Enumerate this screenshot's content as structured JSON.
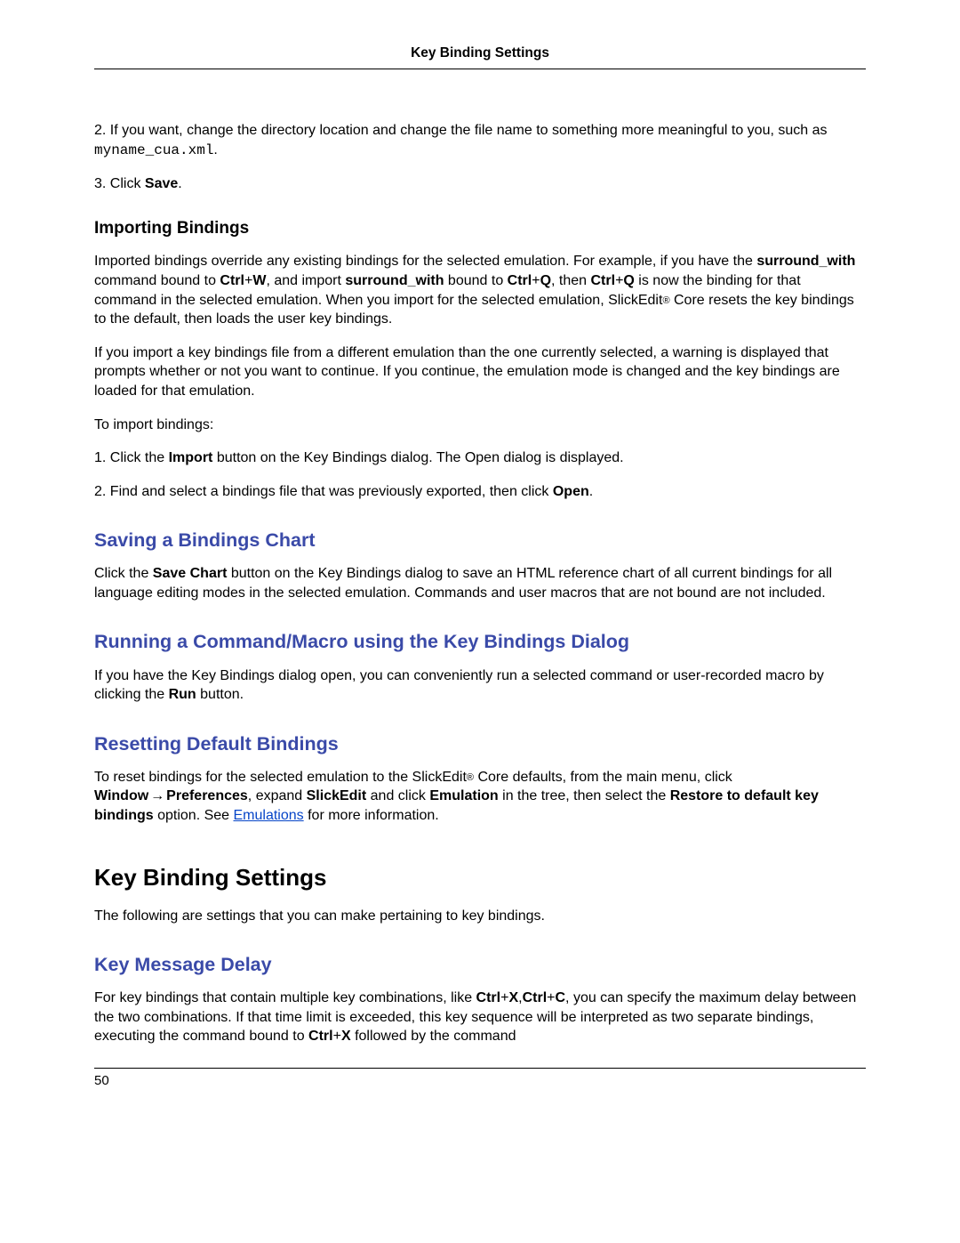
{
  "header": {
    "title": "Key Binding Settings"
  },
  "step2": {
    "num": "2.",
    "pre": "If you want, change the directory location and change the file name to something more meaningful to you, such as ",
    "mono": "myname_cua.xml",
    "post": "."
  },
  "step3": {
    "num": "3.",
    "pre": "Click ",
    "b": "Save",
    "post": "."
  },
  "importing": {
    "heading": "Importing Bindings",
    "p1": {
      "t1": "Imported bindings override any existing bindings for the selected emulation. For example, if you have the ",
      "b1": "surround_with",
      "t2": " command bound to ",
      "b2": "Ctrl",
      "plus1": "+",
      "b3": "W",
      "t3": ", and import ",
      "b4": "surround_with",
      "t4": " bound to ",
      "b5": "Ctrl",
      "plus2": "+",
      "b6": "Q",
      "t5": ", then ",
      "b7": "Ctrl",
      "plus3": "+",
      "b8": "Q",
      "t6": " is now the binding for that command in the selected emulation. When you import for the selected emulation, SlickEdit",
      "reg": "®",
      "t7": " Core resets the key bindings to the default, then loads the user key bindings."
    },
    "p2": "If you import a key bindings file from a different emulation than the one currently selected, a warning is displayed that prompts whether or not you want to continue. If you continue, the emulation mode is changed and the key bindings are loaded for that emulation.",
    "p3": "To import bindings:",
    "s1": {
      "num": "1.",
      "t1": "Click the ",
      "b1": "Import",
      "t2": " button on the Key Bindings dialog. The Open dialog is displayed."
    },
    "s2": {
      "num": "2.",
      "t1": "Find and select a bindings file that was previously exported, then click ",
      "b1": "Open",
      "t2": "."
    }
  },
  "saving": {
    "heading": "Saving a Bindings Chart",
    "p1a": "Click the ",
    "p1b": "Save Chart",
    "p1c": " button on the Key Bindings dialog to save an HTML reference chart of all current bindings for all language editing modes in the selected emulation. Commands and user macros that are not bound are not included."
  },
  "running": {
    "heading": "Running a Command/Macro using the Key Bindings Dialog",
    "p1a": "If you have the Key Bindings dialog open, you can conveniently run a selected command or user-recorded macro by clicking the ",
    "p1b": "Run",
    "p1c": " button."
  },
  "reset": {
    "heading": "Resetting Default Bindings",
    "p": {
      "t1": "To reset bindings for the selected emulation to the SlickEdit",
      "reg": "®",
      "t2": " Core defaults, from the main menu, click ",
      "b1": "Window",
      "arrow": "→",
      "b2": "Preferences",
      "t3": ", expand ",
      "b3": "SlickEdit",
      "t4": " and click ",
      "b4": "Emulation",
      "t5": " in the tree, then select the ",
      "b5": "Restore to default key bindings",
      "t6": " option. See ",
      "link": "Emulations",
      "t7": " for more information."
    }
  },
  "settings": {
    "heading": "Key Binding Settings",
    "intro": "The following are settings that you can make pertaining to key bindings."
  },
  "keymsg": {
    "heading": "Key Message Delay",
    "p": {
      "t1": "For key bindings that contain multiple key combinations, like ",
      "b1": "Ctrl",
      "plus1": "+",
      "b2": "X",
      "comma": ",",
      "b3": "Ctrl",
      "plus2": "+",
      "b4": "C",
      "t2": ", you can specify the maximum delay between the two combinations. If that time limit is exceeded, this key sequence will be interpreted as two separate bindings, executing the command bound to ",
      "b5": "Ctrl",
      "plus3": "+",
      "b6": "X",
      "t3": " followed by the command"
    }
  },
  "footer": {
    "page": "50"
  }
}
